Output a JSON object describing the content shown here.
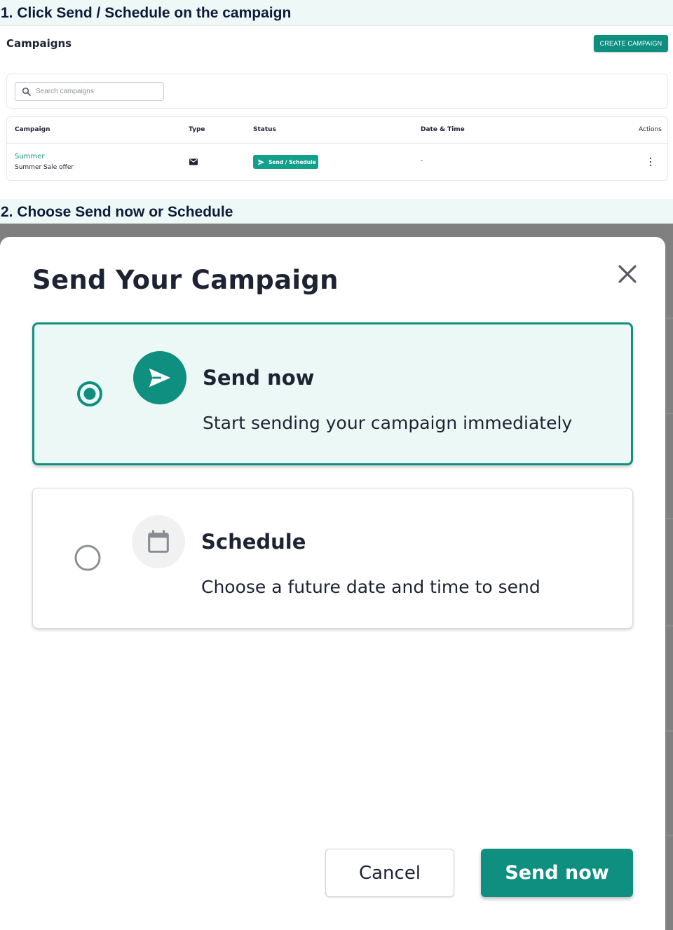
{
  "steps": {
    "step1": "1. Click Send / Schedule on the campaign",
    "step2": "2. Choose Send now or Schedule"
  },
  "campaigns_page": {
    "title": "Campaigns",
    "create_button": "CREATE CAMPAIGN",
    "search_placeholder": "Search campaigns",
    "columns": {
      "campaign": "Campaign",
      "type": "Type",
      "status": "Status",
      "date_time": "Date & Time",
      "actions": "Actions"
    },
    "rows": [
      {
        "name": "Summer",
        "description": "Summer Sale offer",
        "type_icon": "envelope-icon",
        "status_button": "Send / Schedule",
        "date_time": "-",
        "actions_icon": "kebab-menu-icon"
      }
    ]
  },
  "modal": {
    "title": "Send Your Campaign",
    "close_icon": "close-icon",
    "options": [
      {
        "title": "Send now",
        "description": "Start sending your campaign immediately",
        "icon": "paper-plane-icon",
        "selected": true
      },
      {
        "title": "Schedule",
        "description": "Choose a future date and time to send",
        "icon": "calendar-icon",
        "selected": false
      }
    ],
    "cancel_button": "Cancel",
    "submit_button": "Send now"
  },
  "colors": {
    "accent": "#0f8f80",
    "selected_bg": "#ecf8f5",
    "step_header_bg": "#eef8f6",
    "overlay": "#7f7f7f"
  }
}
